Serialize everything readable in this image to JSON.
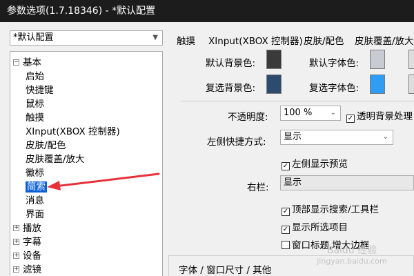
{
  "window": {
    "title": "参数选项(1.7.18346) - *默认配置"
  },
  "profile": {
    "value": "*默认配置"
  },
  "tree": {
    "groups": [
      {
        "label": "基本",
        "expander": "−"
      },
      {
        "label": "播放",
        "expander": "+"
      },
      {
        "label": "字幕",
        "expander": "+"
      },
      {
        "label": "设备",
        "expander": "+"
      },
      {
        "label": "滤镜",
        "expander": "+"
      }
    ],
    "basic_children": [
      "启始",
      "快捷键",
      "鼠标",
      "触摸",
      "XInput(XBOX 控制器)",
      "皮肤/配色",
      "皮肤覆盖/放大",
      "徽标",
      "简索",
      "消息",
      "界面"
    ],
    "selected": "简索"
  },
  "tabs": [
    "触摸",
    "XInput(XBOX 控制器)",
    "皮肤/配色",
    "皮肤覆盖/放大"
  ],
  "colors": {
    "default_bg_label": "默认背景色:",
    "default_font_label": "默认字体色:",
    "selected_bg_label": "复选背景色:",
    "selected_font_label": "复选字体色:",
    "default_bg": "#3a3a3a",
    "default_font": "#c9cbd3",
    "selected_bg": "#2d4a6f",
    "selected_font": "#2f9df4"
  },
  "opacity": {
    "label": "不透明度:",
    "value": "100 %"
  },
  "transparent_bg": {
    "label": "透明背景处理"
  },
  "left_shortcut": {
    "label": "左侧快捷方式:",
    "value": "显示"
  },
  "left_preview": {
    "label": "左侧显示预览"
  },
  "right_bar": {
    "label": "右栏:",
    "value": "显示"
  },
  "top_search": {
    "label": "顶部显示搜索/工具栏"
  },
  "show_selected": {
    "label": "显示所选项目"
  },
  "window_title": {
    "label": "窗口标题,增大边框"
  },
  "bottom_section": {
    "label": "字体 / 窗口尺寸 / 其他"
  },
  "watermark": {
    "line1": "Baidu 经验",
    "line2": "jingyan.baidu.com"
  },
  "accent": {
    "arrow": "#e8303a",
    "selection": "#0a5fd6"
  }
}
